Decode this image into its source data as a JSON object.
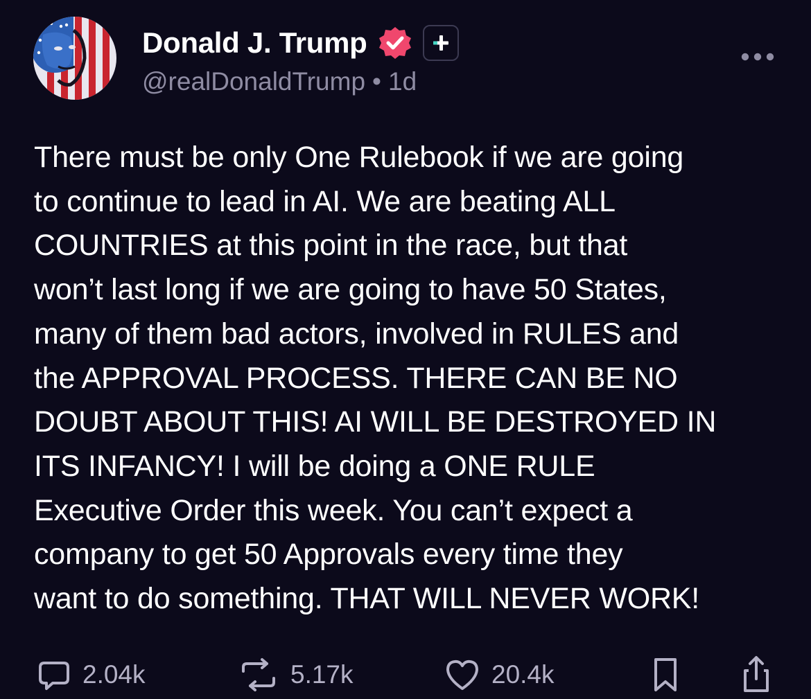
{
  "post": {
    "author": {
      "display_name": "Donald J. Trump",
      "handle": "@realDonaldTrump",
      "separator": "•",
      "time_ago": "1d",
      "verified_icon": "verified-badge-icon",
      "plus_icon": "plus-badge-icon"
    },
    "lines": [
      "There must be only One Rulebook if we are going",
      "to continue to lead in AI. We are beating ALL",
      "COUNTRIES at this point in the race, but that",
      "won’t last long if we are going to have 50 States,",
      "many of them bad actors, involved in RULES and",
      "the APPROVAL PROCESS. THERE CAN BE NO",
      "DOUBT ABOUT THIS! AI WILL BE DESTROYED IN",
      "ITS INFANCY! I will be doing a ONE RULE",
      "Executive Order this week. You can’t expect a",
      "company to get 50 Approvals every time they",
      "want to do something. THAT WILL NEVER WORK!"
    ],
    "actions": {
      "replies": "2.04k",
      "reposts": "5.17k",
      "likes": "20.4k"
    }
  },
  "colors": {
    "background": "#0c0a1b",
    "text": "#ffffff",
    "muted": "#8f8ca3",
    "verified": "#f0476d",
    "plus_accent": "#46d6c4"
  }
}
